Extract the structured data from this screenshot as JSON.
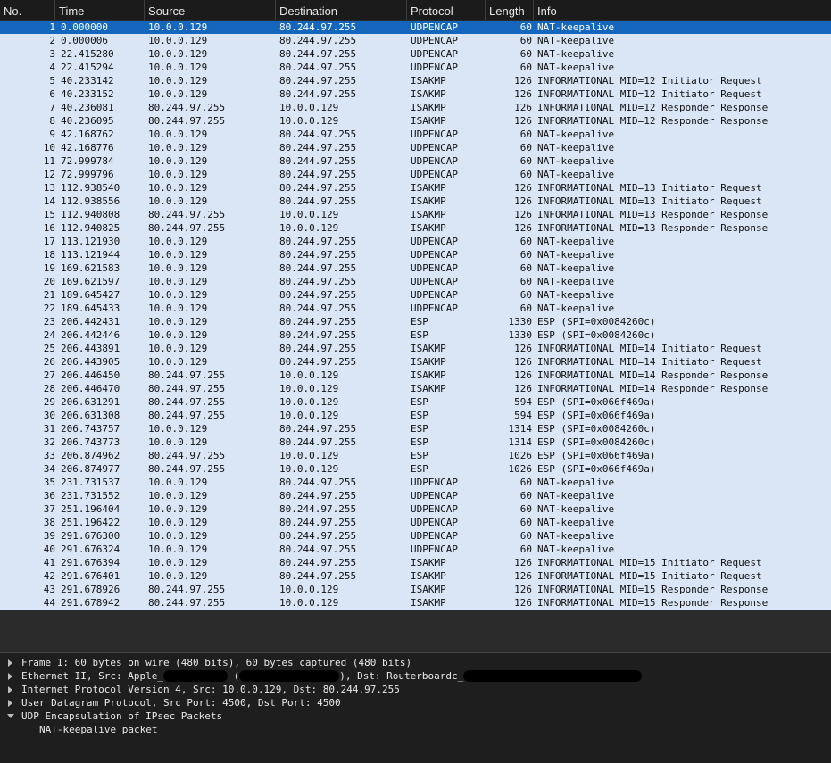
{
  "columns": [
    "No.",
    "Time",
    "Source",
    "Destination",
    "Protocol",
    "Length",
    "Info"
  ],
  "packets": [
    {
      "no": "1",
      "time": "0.000000",
      "src": "10.0.0.129",
      "dst": "80.244.97.255",
      "proto": "UDPENCAP",
      "len": "60",
      "info": "NAT-keepalive",
      "selected": true
    },
    {
      "no": "2",
      "time": "0.000006",
      "src": "10.0.0.129",
      "dst": "80.244.97.255",
      "proto": "UDPENCAP",
      "len": "60",
      "info": "NAT-keepalive"
    },
    {
      "no": "3",
      "time": "22.415280",
      "src": "10.0.0.129",
      "dst": "80.244.97.255",
      "proto": "UDPENCAP",
      "len": "60",
      "info": "NAT-keepalive"
    },
    {
      "no": "4",
      "time": "22.415294",
      "src": "10.0.0.129",
      "dst": "80.244.97.255",
      "proto": "UDPENCAP",
      "len": "60",
      "info": "NAT-keepalive"
    },
    {
      "no": "5",
      "time": "40.233142",
      "src": "10.0.0.129",
      "dst": "80.244.97.255",
      "proto": "ISAKMP",
      "len": "126",
      "info": "INFORMATIONAL MID=12 Initiator Request"
    },
    {
      "no": "6",
      "time": "40.233152",
      "src": "10.0.0.129",
      "dst": "80.244.97.255",
      "proto": "ISAKMP",
      "len": "126",
      "info": "INFORMATIONAL MID=12 Initiator Request"
    },
    {
      "no": "7",
      "time": "40.236081",
      "src": "80.244.97.255",
      "dst": "10.0.0.129",
      "proto": "ISAKMP",
      "len": "126",
      "info": "INFORMATIONAL MID=12 Responder Response"
    },
    {
      "no": "8",
      "time": "40.236095",
      "src": "80.244.97.255",
      "dst": "10.0.0.129",
      "proto": "ISAKMP",
      "len": "126",
      "info": "INFORMATIONAL MID=12 Responder Response"
    },
    {
      "no": "9",
      "time": "42.168762",
      "src": "10.0.0.129",
      "dst": "80.244.97.255",
      "proto": "UDPENCAP",
      "len": "60",
      "info": "NAT-keepalive"
    },
    {
      "no": "10",
      "time": "42.168776",
      "src": "10.0.0.129",
      "dst": "80.244.97.255",
      "proto": "UDPENCAP",
      "len": "60",
      "info": "NAT-keepalive"
    },
    {
      "no": "11",
      "time": "72.999784",
      "src": "10.0.0.129",
      "dst": "80.244.97.255",
      "proto": "UDPENCAP",
      "len": "60",
      "info": "NAT-keepalive"
    },
    {
      "no": "12",
      "time": "72.999796",
      "src": "10.0.0.129",
      "dst": "80.244.97.255",
      "proto": "UDPENCAP",
      "len": "60",
      "info": "NAT-keepalive"
    },
    {
      "no": "13",
      "time": "112.938540",
      "src": "10.0.0.129",
      "dst": "80.244.97.255",
      "proto": "ISAKMP",
      "len": "126",
      "info": "INFORMATIONAL MID=13 Initiator Request"
    },
    {
      "no": "14",
      "time": "112.938556",
      "src": "10.0.0.129",
      "dst": "80.244.97.255",
      "proto": "ISAKMP",
      "len": "126",
      "info": "INFORMATIONAL MID=13 Initiator Request"
    },
    {
      "no": "15",
      "time": "112.940808",
      "src": "80.244.97.255",
      "dst": "10.0.0.129",
      "proto": "ISAKMP",
      "len": "126",
      "info": "INFORMATIONAL MID=13 Responder Response"
    },
    {
      "no": "16",
      "time": "112.940825",
      "src": "80.244.97.255",
      "dst": "10.0.0.129",
      "proto": "ISAKMP",
      "len": "126",
      "info": "INFORMATIONAL MID=13 Responder Response"
    },
    {
      "no": "17",
      "time": "113.121930",
      "src": "10.0.0.129",
      "dst": "80.244.97.255",
      "proto": "UDPENCAP",
      "len": "60",
      "info": "NAT-keepalive"
    },
    {
      "no": "18",
      "time": "113.121944",
      "src": "10.0.0.129",
      "dst": "80.244.97.255",
      "proto": "UDPENCAP",
      "len": "60",
      "info": "NAT-keepalive"
    },
    {
      "no": "19",
      "time": "169.621583",
      "src": "10.0.0.129",
      "dst": "80.244.97.255",
      "proto": "UDPENCAP",
      "len": "60",
      "info": "NAT-keepalive"
    },
    {
      "no": "20",
      "time": "169.621597",
      "src": "10.0.0.129",
      "dst": "80.244.97.255",
      "proto": "UDPENCAP",
      "len": "60",
      "info": "NAT-keepalive"
    },
    {
      "no": "21",
      "time": "189.645427",
      "src": "10.0.0.129",
      "dst": "80.244.97.255",
      "proto": "UDPENCAP",
      "len": "60",
      "info": "NAT-keepalive"
    },
    {
      "no": "22",
      "time": "189.645433",
      "src": "10.0.0.129",
      "dst": "80.244.97.255",
      "proto": "UDPENCAP",
      "len": "60",
      "info": "NAT-keepalive"
    },
    {
      "no": "23",
      "time": "206.442431",
      "src": "10.0.0.129",
      "dst": "80.244.97.255",
      "proto": "ESP",
      "len": "1330",
      "info": "ESP (SPI=0x0084260c)"
    },
    {
      "no": "24",
      "time": "206.442446",
      "src": "10.0.0.129",
      "dst": "80.244.97.255",
      "proto": "ESP",
      "len": "1330",
      "info": "ESP (SPI=0x0084260c)"
    },
    {
      "no": "25",
      "time": "206.443891",
      "src": "10.0.0.129",
      "dst": "80.244.97.255",
      "proto": "ISAKMP",
      "len": "126",
      "info": "INFORMATIONAL MID=14 Initiator Request"
    },
    {
      "no": "26",
      "time": "206.443905",
      "src": "10.0.0.129",
      "dst": "80.244.97.255",
      "proto": "ISAKMP",
      "len": "126",
      "info": "INFORMATIONAL MID=14 Initiator Request"
    },
    {
      "no": "27",
      "time": "206.446450",
      "src": "80.244.97.255",
      "dst": "10.0.0.129",
      "proto": "ISAKMP",
      "len": "126",
      "info": "INFORMATIONAL MID=14 Responder Response"
    },
    {
      "no": "28",
      "time": "206.446470",
      "src": "80.244.97.255",
      "dst": "10.0.0.129",
      "proto": "ISAKMP",
      "len": "126",
      "info": "INFORMATIONAL MID=14 Responder Response"
    },
    {
      "no": "29",
      "time": "206.631291",
      "src": "80.244.97.255",
      "dst": "10.0.0.129",
      "proto": "ESP",
      "len": "594",
      "info": "ESP (SPI=0x066f469a)"
    },
    {
      "no": "30",
      "time": "206.631308",
      "src": "80.244.97.255",
      "dst": "10.0.0.129",
      "proto": "ESP",
      "len": "594",
      "info": "ESP (SPI=0x066f469a)"
    },
    {
      "no": "31",
      "time": "206.743757",
      "src": "10.0.0.129",
      "dst": "80.244.97.255",
      "proto": "ESP",
      "len": "1314",
      "info": "ESP (SPI=0x0084260c)"
    },
    {
      "no": "32",
      "time": "206.743773",
      "src": "10.0.0.129",
      "dst": "80.244.97.255",
      "proto": "ESP",
      "len": "1314",
      "info": "ESP (SPI=0x0084260c)"
    },
    {
      "no": "33",
      "time": "206.874962",
      "src": "80.244.97.255",
      "dst": "10.0.0.129",
      "proto": "ESP",
      "len": "1026",
      "info": "ESP (SPI=0x066f469a)"
    },
    {
      "no": "34",
      "time": "206.874977",
      "src": "80.244.97.255",
      "dst": "10.0.0.129",
      "proto": "ESP",
      "len": "1026",
      "info": "ESP (SPI=0x066f469a)"
    },
    {
      "no": "35",
      "time": "231.731537",
      "src": "10.0.0.129",
      "dst": "80.244.97.255",
      "proto": "UDPENCAP",
      "len": "60",
      "info": "NAT-keepalive"
    },
    {
      "no": "36",
      "time": "231.731552",
      "src": "10.0.0.129",
      "dst": "80.244.97.255",
      "proto": "UDPENCAP",
      "len": "60",
      "info": "NAT-keepalive"
    },
    {
      "no": "37",
      "time": "251.196404",
      "src": "10.0.0.129",
      "dst": "80.244.97.255",
      "proto": "UDPENCAP",
      "len": "60",
      "info": "NAT-keepalive"
    },
    {
      "no": "38",
      "time": "251.196422",
      "src": "10.0.0.129",
      "dst": "80.244.97.255",
      "proto": "UDPENCAP",
      "len": "60",
      "info": "NAT-keepalive"
    },
    {
      "no": "39",
      "time": "291.676300",
      "src": "10.0.0.129",
      "dst": "80.244.97.255",
      "proto": "UDPENCAP",
      "len": "60",
      "info": "NAT-keepalive"
    },
    {
      "no": "40",
      "time": "291.676324",
      "src": "10.0.0.129",
      "dst": "80.244.97.255",
      "proto": "UDPENCAP",
      "len": "60",
      "info": "NAT-keepalive"
    },
    {
      "no": "41",
      "time": "291.676394",
      "src": "10.0.0.129",
      "dst": "80.244.97.255",
      "proto": "ISAKMP",
      "len": "126",
      "info": "INFORMATIONAL MID=15 Initiator Request"
    },
    {
      "no": "42",
      "time": "291.676401",
      "src": "10.0.0.129",
      "dst": "80.244.97.255",
      "proto": "ISAKMP",
      "len": "126",
      "info": "INFORMATIONAL MID=15 Initiator Request"
    },
    {
      "no": "43",
      "time": "291.678926",
      "src": "80.244.97.255",
      "dst": "10.0.0.129",
      "proto": "ISAKMP",
      "len": "126",
      "info": "INFORMATIONAL MID=15 Responder Response"
    },
    {
      "no": "44",
      "time": "291.678942",
      "src": "80.244.97.255",
      "dst": "10.0.0.129",
      "proto": "ISAKMP",
      "len": "126",
      "info": "INFORMATIONAL MID=15 Responder Response"
    }
  ],
  "details": {
    "frame": "Frame 1: 60 bytes on wire (480 bits), 60 bytes captured (480 bits)",
    "ethernet_prefix": "Ethernet II, Src: Apple_",
    "ethernet_mid1": " (",
    "ethernet_mid2": "), Dst: Routerboardc_",
    "ip": "Internet Protocol Version 4, Src: 10.0.0.129, Dst: 80.244.97.255",
    "udp": "User Datagram Protocol, Src Port: 4500, Dst Port: 4500",
    "udpencap": "UDP Encapsulation of IPsec Packets",
    "udpencap_child": "NAT-keepalive packet"
  },
  "colors": {
    "row_bg": "#dae6f6",
    "selected_bg": "#1566bd",
    "header_bg": "#1b1b1b",
    "details_bg": "#1e1e1e"
  }
}
